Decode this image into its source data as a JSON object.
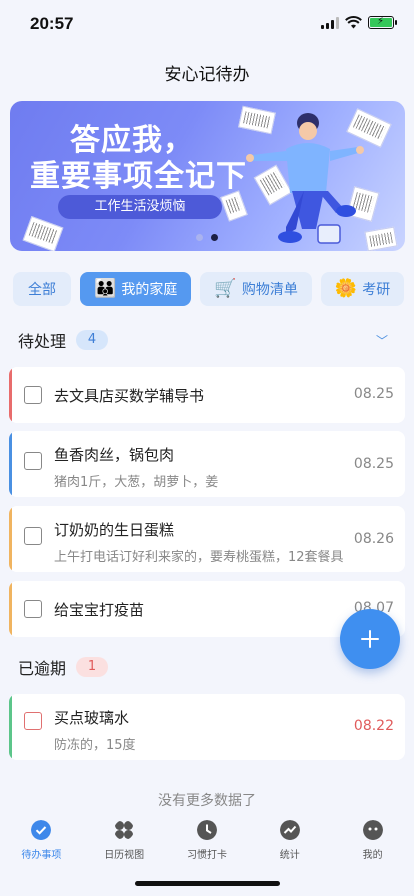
{
  "status_bar": {
    "time": "20:57"
  },
  "header": {
    "title": "安心记待办"
  },
  "banner": {
    "line1": "答应我，",
    "line2": "重要事项全记下",
    "tagline": "工作生活没烦恼",
    "page_count": 2,
    "active_page": 2
  },
  "tabs": [
    {
      "label": "全部",
      "emoji": ""
    },
    {
      "label": "我的家庭",
      "emoji": "👪"
    },
    {
      "label": "购物清单",
      "emoji": "🛒"
    },
    {
      "label": "考研",
      "emoji": "🌼"
    }
  ],
  "pending": {
    "title": "待处理",
    "count": "4",
    "items": [
      {
        "title": "去文具店买数学辅导书",
        "note": "",
        "date": "08.25",
        "color": "#e86c6c"
      },
      {
        "title": "鱼香肉丝，锅包肉",
        "note": "猪肉1斤，大葱，胡萝卜，姜",
        "date": "08.25",
        "color": "#4a90e2"
      },
      {
        "title": "订奶奶的生日蛋糕",
        "note": "上午打电话订好利来家的，要寿桃蛋糕，12套餐具",
        "date": "08.26",
        "color": "#f0b460"
      },
      {
        "title": "给宝宝打疫苗",
        "note": "",
        "date": "08.07",
        "color": "#f0b460"
      }
    ]
  },
  "overdue": {
    "title": "已逾期",
    "count": "1",
    "items": [
      {
        "title": "买点玻璃水",
        "note": "防冻的，15度",
        "date": "08.22",
        "color": "#5cc58a"
      }
    ]
  },
  "no_more_text": "没有更多数据了",
  "bottom_nav": [
    {
      "label": "待办事项",
      "icon": "check-circle-icon",
      "active": true
    },
    {
      "label": "日历视图",
      "icon": "grid-icon",
      "active": false
    },
    {
      "label": "习惯打卡",
      "icon": "clock-icon",
      "active": false
    },
    {
      "label": "统计",
      "icon": "chart-icon",
      "active": false
    },
    {
      "label": "我的",
      "icon": "profile-icon",
      "active": false
    }
  ],
  "colors": {
    "accent": "#3e88ea",
    "overdue_date": "#e05b5b"
  }
}
